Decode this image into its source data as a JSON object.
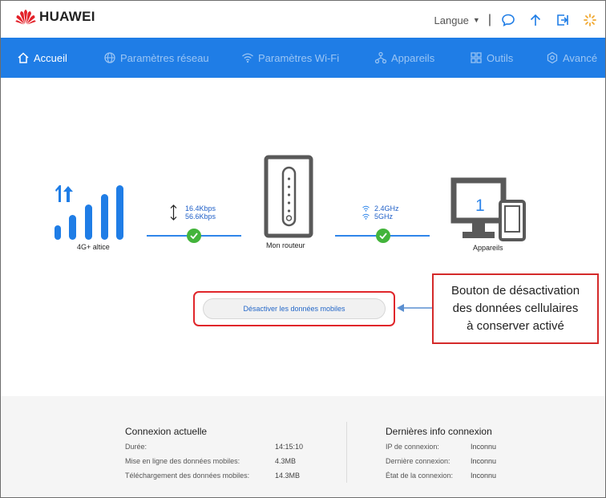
{
  "header": {
    "brand": "HUAWEI",
    "language_label": "Langue",
    "separator": "|",
    "icons": [
      "chat-icon",
      "arrow-up-icon",
      "logout-icon",
      "loading-icon"
    ]
  },
  "nav": {
    "items": [
      {
        "label": "Accueil",
        "icon": "home-icon",
        "active": true
      },
      {
        "label": "Paramètres réseau",
        "icon": "globe-icon"
      },
      {
        "label": "Paramètres Wi-Fi",
        "icon": "wifi-icon"
      },
      {
        "label": "Appareils",
        "icon": "devices-icon"
      },
      {
        "label": "Outils",
        "icon": "grid-icon"
      },
      {
        "label": "Avancé",
        "icon": "gear-icon"
      }
    ]
  },
  "status": {
    "network_label": "4G+  altice",
    "upload_speed": "16.4Kbps",
    "download_speed": "56.6Kbps",
    "router_label": "Mon routeur",
    "wifi_24": "2.4GHz",
    "wifi_5": "5GHz",
    "devices_count": "1",
    "devices_label": "Appareils"
  },
  "mobile_data_button": "Désactiver les données mobiles",
  "callout": {
    "line1": "Bouton de désactivation",
    "line2": "des données cellulaires",
    "line3": "à conserver activé"
  },
  "current_connection": {
    "title": "Connexion actuelle",
    "rows": [
      {
        "label": "Durée:",
        "value": "14:15:10"
      },
      {
        "label": "Mise en ligne des données mobiles:",
        "value": "4.3MB"
      },
      {
        "label": "Téléchargement des données mobiles:",
        "value": "14.3MB"
      }
    ]
  },
  "last_connection": {
    "title": "Dernières info connexion",
    "rows": [
      {
        "label": "IP de connexion:",
        "value": "Inconnu"
      },
      {
        "label": "Dernière connexion:",
        "value": "Inconnu"
      },
      {
        "label": "État de la connexion:",
        "value": "Inconnu"
      }
    ]
  },
  "colors": {
    "nav_bg": "#1f7de6",
    "accent": "#2f86ea",
    "ok_green": "#43b43b",
    "brand_red": "#e3222a",
    "annotation_red": "#d42a2a"
  }
}
